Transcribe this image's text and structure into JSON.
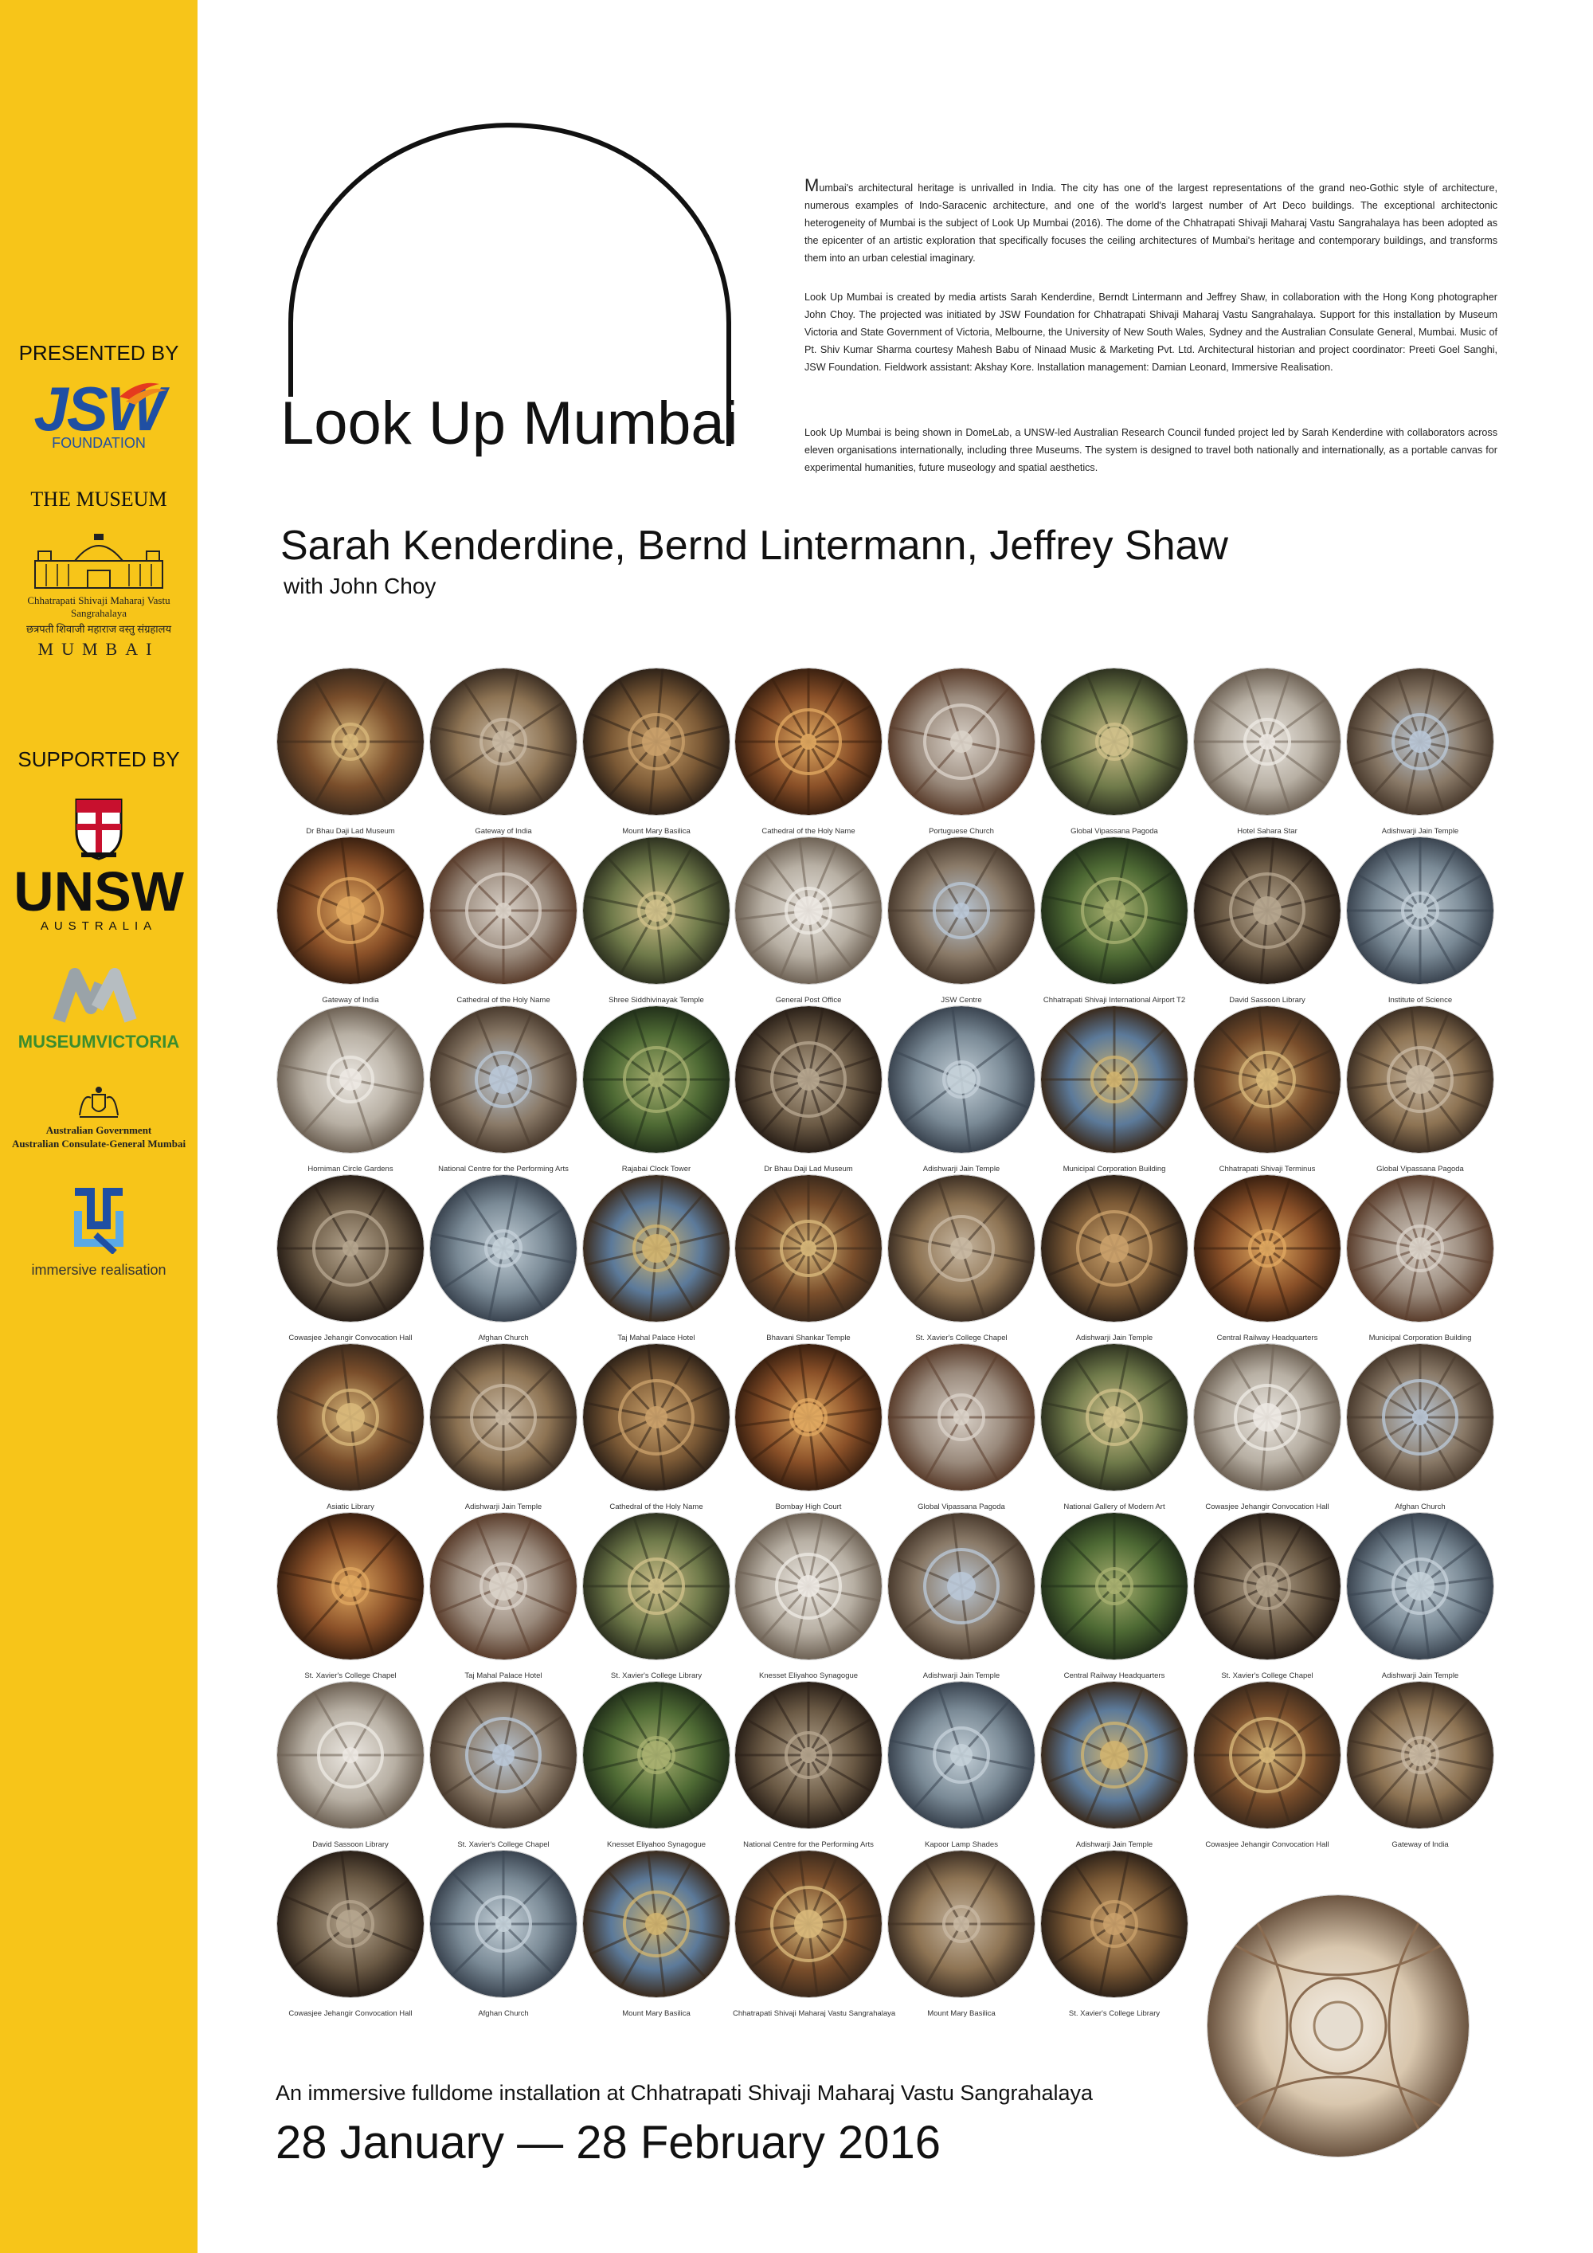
{
  "sidebar": {
    "presented_by": "PRESENTED BY",
    "jsw_logo": "JSW",
    "jsw_sub": "FOUNDATION",
    "the_museum": "THE MUSEUM",
    "museum_caption": "Chhatrapati Shivaji Maharaj Vastu Sangrahalaya",
    "museum_caption_hindi": "छत्रपती शिवाजी महाराज वस्तु संग्रहालय",
    "museum_city": "MUMBAI",
    "supported_by": "SUPPORTED BY",
    "unsw": "UNSW",
    "unsw_sub": "AUSTRALIA",
    "museum_victoria": "MUSEUMVICTORIA",
    "gov_line1": "Australian Government",
    "gov_line2": "Australian Consulate-General Mumbai",
    "immersive": "immersive realisation",
    "colors": {
      "background": "#f7c519",
      "jsw_blue": "#1f4fa3",
      "mv_green": "#3b8d2e"
    }
  },
  "header": {
    "title": "Look Up Mumbai",
    "paragraphs": [
      "Mumbai's architectural heritage is unrivalled in India. The city has one of the largest representations of the grand neo-Gothic style of architecture, numerous examples of Indo-Saracenic architecture, and one of the world's largest number of Art Deco buildings.  The exceptional architectonic heterogeneity of Mumbai is the subject of Look Up Mumbai (2016). The dome of the Chhatrapati Shivaji Maharaj Vastu Sangrahalaya has been adopted as the epicenter of an artistic exploration that specifically focuses the ceiling architectures of Mumbai's heritage and contemporary buildings, and transforms them into an urban celestial imaginary.",
      "Look Up Mumbai is created by media artists Sarah Kenderdine, Berndt Lintermann and Jeffrey Shaw, in collaboration with the Hong Kong photographer John Choy. The projected was initiated by JSW Foundation for Chhatrapati Shivaji Maharaj Vastu Sangrahalaya. Support for this installation by Museum Victoria and State Government of Victoria, Melbourne, the University of New South Wales, Sydney and the Australian Consulate General, Mumbai. Music of Pt. Shiv Kumar Sharma courtesy Mahesh Babu of Ninaad Music & Marketing Pvt. Ltd. Architectural historian and project coordinator: Preeti Goel Sanghi, JSW Foundation. Fieldwork assistant: Akshay Kore. Installation management: Damian Leonard, Immersive Realisation.",
      "Look Up Mumbai is being shown in DomeLab, a UNSW-led Australian Research Council funded project led by Sarah Kenderdine with collaborators across eleven organisations internationally, including three Museums. The system is designed to travel both nationally and internationally, as a portable canvas for experimental humanities, future museology and spatial aesthetics."
    ],
    "artists": "Sarah Kenderdine, Bernd Lintermann, Jeffrey Shaw",
    "with": "with John Choy"
  },
  "gallery": {
    "rows": [
      [
        "Dr Bhau Daji Lad Museum",
        "Gateway of India",
        "Mount Mary Basilica",
        "Cathedral of the Holy Name",
        "Portuguese Church",
        "Global Vipassana Pagoda",
        "Hotel Sahara Star",
        "Adishwarji Jain Temple"
      ],
      [
        "Gateway of India",
        "Cathedral of the Holy Name",
        "Shree Siddhivinayak Temple",
        "General Post Office",
        "JSW Centre",
        "Chhatrapati Shivaji International Airport T2",
        "David Sassoon Library",
        "Institute of Science"
      ],
      [
        "Horniman Circle Gardens",
        "National Centre for the Performing Arts",
        "Rajabai Clock Tower",
        "Dr Bhau Daji Lad Museum",
        "Adishwarji Jain Temple",
        "Municipal Corporation Building",
        "Chhatrapati Shivaji Terminus",
        "Global Vipassana Pagoda"
      ],
      [
        "Cowasjee Jehangir Convocation Hall",
        "Afghan Church",
        "Taj Mahal Palace Hotel",
        "Bhavani Shankar Temple",
        "St. Xavier's College Chapel",
        "Adishwarji Jain Temple",
        "Central Railway Headquarters",
        "Municipal Corporation Building"
      ],
      [
        "Asiatic Library",
        "Adishwarji Jain Temple",
        "Cathedral of the Holy Name",
        "Bombay High Court",
        "Global Vipassana Pagoda",
        "National Gallery of Modern Art",
        "Cowasjee Jehangir Convocation Hall",
        "Afghan Church"
      ],
      [
        "St. Xavier's College Chapel",
        "Taj Mahal Palace Hotel",
        "St. Xavier's College Library",
        "Knesset Eliyahoo Synagogue",
        "Adishwarji Jain Temple",
        "Central Railway Headquarters",
        "St. Xavier's College Chapel",
        "Adishwarji Jain Temple"
      ],
      [
        "David Sassoon Library",
        "St. Xavier's College Chapel",
        "Knesset Eliyahoo Synagogue",
        "National Centre for the Performing Arts",
        "Kapoor Lamp Shades",
        "Adishwarji Jain Temple",
        "Cowasjee Jehangir Convocation Hall",
        "Gateway of India"
      ],
      [
        "Cowasjee Jehangir Convocation Hall",
        "Afghan Church",
        "Mount Mary Basilica",
        "Chhatrapati Shivaji Maharaj Vastu Sangrahalaya",
        "Mount Mary Basilica",
        "St. Xavier's College Library"
      ]
    ]
  },
  "footer": {
    "subtitle": "An immersive fulldome installation at Chhatrapati Shivaji Maharaj Vastu Sangrahalaya",
    "dates": "28 January — 28 February 2016"
  }
}
